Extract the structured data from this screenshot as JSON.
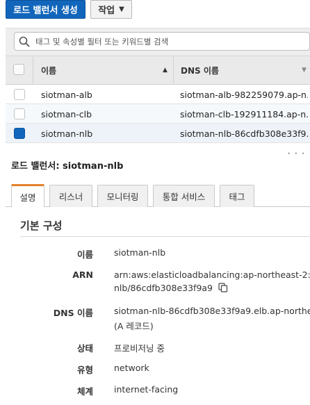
{
  "toolbar": {
    "create_label": "로드 밸런서 생성",
    "actions_label": "작업"
  },
  "search": {
    "placeholder": "태그 및 속성별 필터 또는 키워드별 검색"
  },
  "table": {
    "columns": [
      "이름",
      "DNS 이름"
    ],
    "rows": [
      {
        "name": "siotman-alb",
        "dns": "siotman-alb-982259079.ap-n...",
        "checked": false
      },
      {
        "name": "siotman-clb",
        "dns": "siotman-clb-192911184.ap-n...",
        "checked": false
      },
      {
        "name": "siotman-nlb",
        "dns": "siotman-nlb-86cdfb308e33f9...",
        "checked": true
      }
    ]
  },
  "detail": {
    "header": "로드 밸런서: siotman-nlb",
    "tabs": [
      "설명",
      "리스너",
      "모니터링",
      "통합 서비스",
      "태그"
    ],
    "active_tab": "설명",
    "section_title": "기본 구성",
    "fields": {
      "name_label": "이름",
      "name_value": "siotman-nlb",
      "arn_label": "ARN",
      "arn_line1": "arn:aws:elasticloadbalancing:ap-northeast-2:",
      "arn_line2": "nlb/86cdfb308e33f9a9",
      "dns_label": "DNS 이름",
      "dns_line1": "siotman-nlb-86cdfb308e33f9a9.elb.ap-northe",
      "dns_line2": "(A 레코드)",
      "state_label": "상태",
      "state_value": "프로비저닝 중",
      "type_label": "유형",
      "type_value": "network",
      "scheme_label": "체계",
      "scheme_value": "internet-facing"
    }
  },
  "colors": {
    "primary": "#1166bb",
    "tab_accent": "#e5812b"
  },
  "icons": [
    "search-icon",
    "chevron-down-icon",
    "sort-up-icon",
    "sort-down-icon",
    "copy-icon"
  ]
}
